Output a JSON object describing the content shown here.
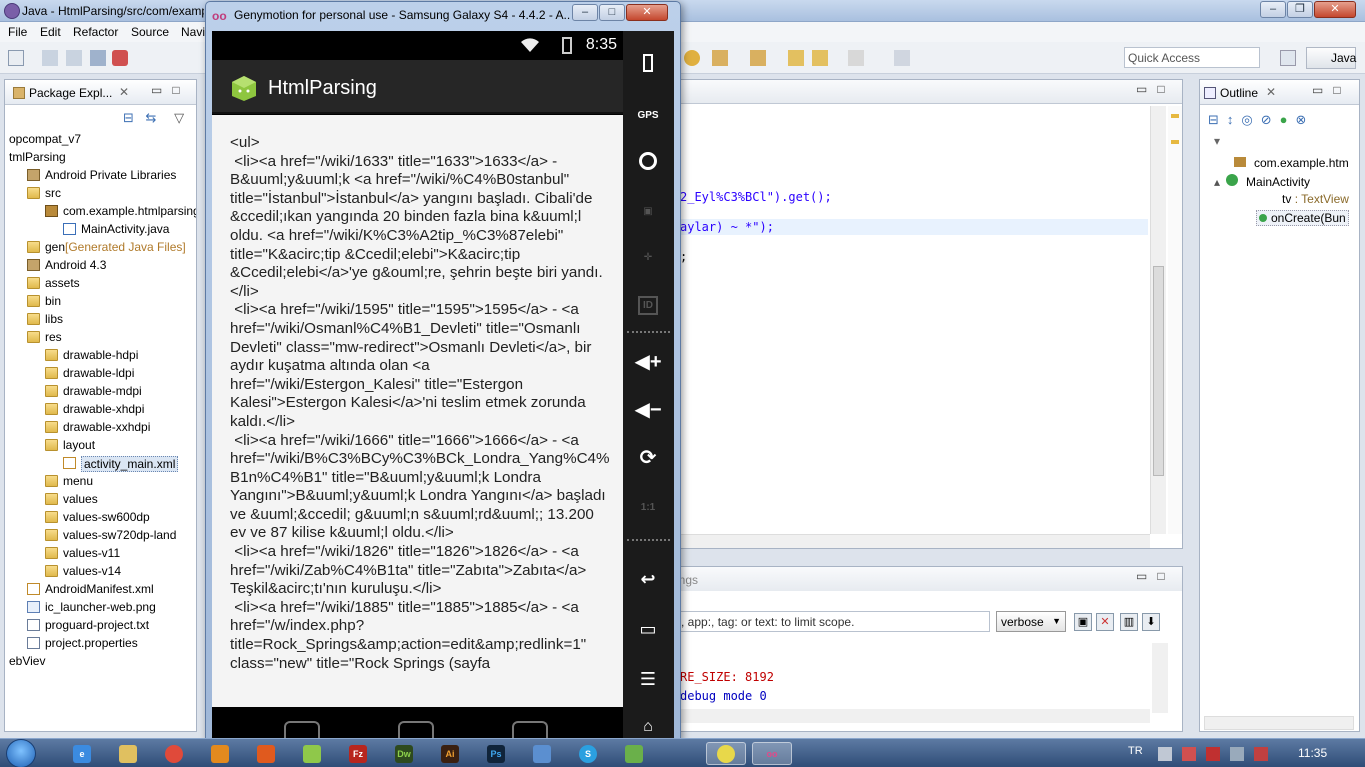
{
  "eclipse": {
    "title": "Java - HtmlParsing/src/com/examp",
    "menu": [
      "File",
      "Edit",
      "Refactor",
      "Source",
      "Navi"
    ],
    "quick_access_placeholder": "Quick Access",
    "perspective": "Java"
  },
  "package_explorer": {
    "tab_label": "Package Expl...",
    "items": [
      {
        "label": "opcompat_v7",
        "indent": 0,
        "icon": "none"
      },
      {
        "label": "tmlParsing",
        "indent": 0,
        "icon": "none"
      },
      {
        "label": "Android Private Libraries",
        "indent": 1,
        "icon": "lib"
      },
      {
        "label": "src",
        "indent": 1,
        "icon": "folder"
      },
      {
        "label": "com.example.htmlparsing",
        "indent": 2,
        "icon": "pkg"
      },
      {
        "label": "MainActivity.java",
        "indent": 3,
        "icon": "java"
      },
      {
        "label": "gen",
        "note": "[Generated Java Files]",
        "indent": 1,
        "icon": "folder"
      },
      {
        "label": "Android 4.3",
        "indent": 1,
        "icon": "lib"
      },
      {
        "label": "assets",
        "indent": 1,
        "icon": "folder"
      },
      {
        "label": "bin",
        "indent": 1,
        "icon": "folder"
      },
      {
        "label": "libs",
        "indent": 1,
        "icon": "folder"
      },
      {
        "label": "res",
        "indent": 1,
        "icon": "folder"
      },
      {
        "label": "drawable-hdpi",
        "indent": 2,
        "icon": "folder"
      },
      {
        "label": "drawable-ldpi",
        "indent": 2,
        "icon": "folder"
      },
      {
        "label": "drawable-mdpi",
        "indent": 2,
        "icon": "folder"
      },
      {
        "label": "drawable-xhdpi",
        "indent": 2,
        "icon": "folder"
      },
      {
        "label": "drawable-xxhdpi",
        "indent": 2,
        "icon": "folder"
      },
      {
        "label": "layout",
        "indent": 2,
        "icon": "folder"
      },
      {
        "label": "activity_main.xml",
        "indent": 3,
        "icon": "xml",
        "selected": true
      },
      {
        "label": "menu",
        "indent": 2,
        "icon": "folder"
      },
      {
        "label": "values",
        "indent": 2,
        "icon": "folder"
      },
      {
        "label": "values-sw600dp",
        "indent": 2,
        "icon": "folder"
      },
      {
        "label": "values-sw720dp-land",
        "indent": 2,
        "icon": "folder"
      },
      {
        "label": "values-v11",
        "indent": 2,
        "icon": "folder"
      },
      {
        "label": "values-v14",
        "indent": 2,
        "icon": "folder"
      },
      {
        "label": "AndroidManifest.xml",
        "indent": 1,
        "icon": "xml"
      },
      {
        "label": "ic_launcher-web.png",
        "indent": 1,
        "icon": "png"
      },
      {
        "label": "proguard-project.txt",
        "indent": 1,
        "icon": "file"
      },
      {
        "label": "project.properties",
        "indent": 1,
        "icon": "file"
      },
      {
        "label": "ebViev",
        "indent": 0,
        "icon": "none"
      }
    ]
  },
  "editor": {
    "line1": "2_Eyl%C3%BCl\").get();",
    "line2": "aylar) ~ *\");",
    "line3": ";"
  },
  "logcat": {
    "tab_label": "ings",
    "filter_placeholder": ", app:, tag: or text: to limit scope.",
    "level": "verbose",
    "line1": "RE_SIZE: 8192",
    "line2": "debug mode 0"
  },
  "outline": {
    "tab_label": "Outline",
    "package": "com.example.htm",
    "class": "MainActivity",
    "field_name": "tv",
    "field_type": ": TextView",
    "method": "onCreate(Bun"
  },
  "genymotion": {
    "window_title": "Genymotion for personal use - Samsung Galaxy S4 - 4.4.2 - A...",
    "status_time": "8:35",
    "app_title": "HtmlParsing",
    "content_text": "<ul>\n <li><a href=\"/wiki/1633\" title=\"1633\">1633</a> - B&uuml;y&uuml;k <a href=\"/wiki/%C4%B0stanbul\" title=\"İstanbul\">İstanbul</a> yangını başladı. Cibali'de &ccedil;ıkan yangında 20 binden fazla bina k&uuml;l oldu. <a href=\"/wiki/K%C3%A2tip_%C3%87elebi\" title=\"K&acirc;tip &Ccedil;elebi\">K&acirc;tip &Ccedil;elebi</a>'ye g&ouml;re, şehrin beşte biri yandı.</li>\n <li><a href=\"/wiki/1595\" title=\"1595\">1595</a> - <a href=\"/wiki/Osmanl%C4%B1_Devleti\" title=\"Osmanlı Devleti\" class=\"mw-redirect\">Osmanlı Devleti</a>, bir aydır kuşatma altında olan <a href=\"/wiki/Estergon_Kalesi\" title=\"Estergon Kalesi\">Estergon Kalesi</a>'ni teslim etmek zorunda kaldı.</li>\n <li><a href=\"/wiki/1666\" title=\"1666\">1666</a> - <a href=\"/wiki/B%C3%BCy%C3%BCk_Londra_Yang%C4%B1n%C4%B1\" title=\"B&uuml;y&uuml;k Londra Yangını\">B&uuml;y&uuml;k Londra Yangını</a> başladı ve &uuml;&ccedil; g&uuml;n s&uuml;rd&uuml;; 13.200 ev ve 87 kilise k&uuml;l oldu.</li>\n <li><a href=\"/wiki/1826\" title=\"1826\">1826</a> - <a href=\"/wiki/Zab%C4%B1ta\" title=\"Zabıta\">Zabıta</a> Teşkil&acirc;tı'nın kuruluşu.</li>\n <li><a href=\"/wiki/1885\" title=\"1885\">1885</a> - <a href=\"/w/index.php?title=Rock_Springs&amp;action=edit&amp;redlink=1\" class=\"new\" title=\"Rock Springs (sayfa"
  },
  "taskbar": {
    "lang": "TR",
    "time": "11:35"
  }
}
